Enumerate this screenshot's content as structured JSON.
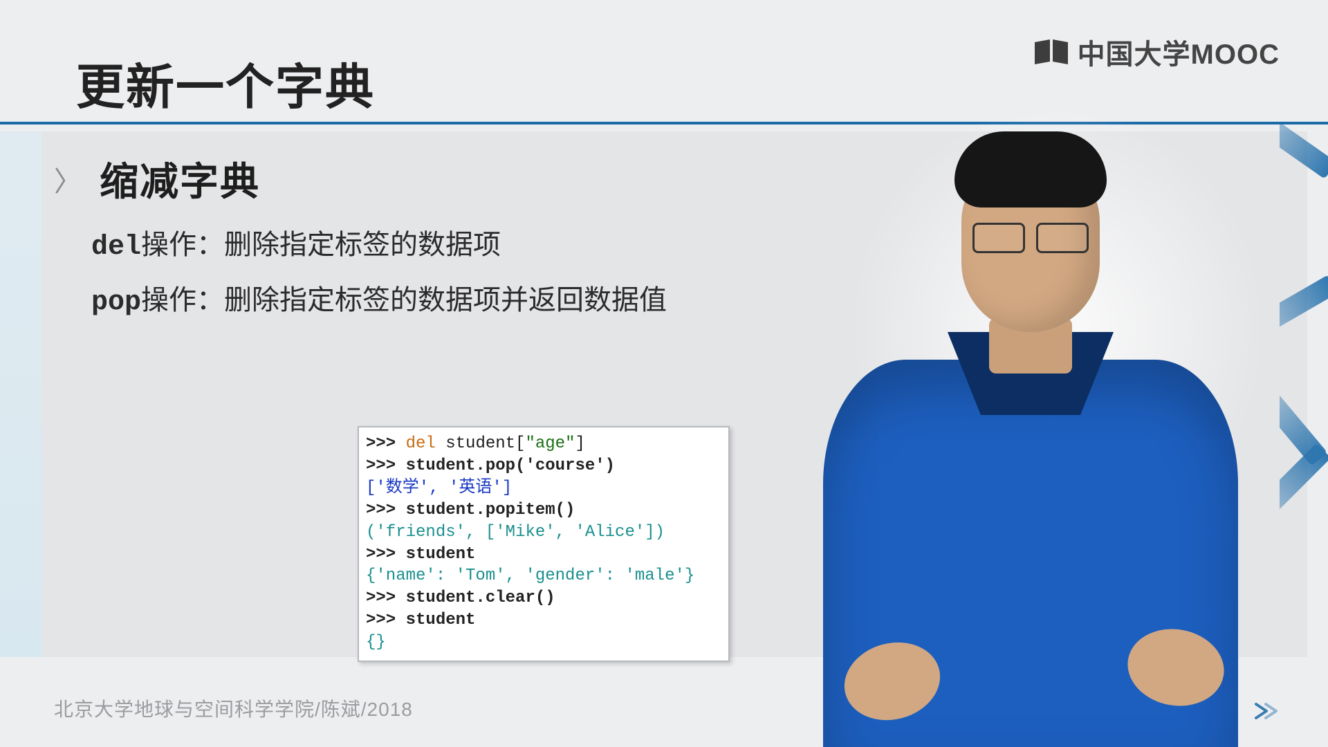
{
  "logo": {
    "text": "中国大学MOOC"
  },
  "title": "更新一个字典",
  "subtitle_marker": "〉",
  "subtitle": "缩减字典",
  "bullets": [
    {
      "kw": "del",
      "label": "操作：",
      "desc": "删除指定标签的数据项"
    },
    {
      "kw": "pop",
      "label": "操作：",
      "desc": "删除指定标签的数据项并返回数据值"
    }
  ],
  "code": {
    "l1_prompt": ">>> ",
    "l1_kw": "del",
    "l1_rest_a": " student[",
    "l1_str": "\"age\"",
    "l1_rest_b": "]",
    "l2": ">>> student.pop('course')",
    "l3": "['数学', '英语']",
    "l4": ">>> student.popitem()",
    "l5": "('friends', ['Mike', 'Alice'])",
    "l6": ">>> student",
    "l7": "{'name': 'Tom', 'gender': 'male'}",
    "l8": ">>> student.clear()",
    "l9": ">>> student",
    "l10": "{}"
  },
  "footer": "北京大学地球与空间科学学院/陈斌/2018"
}
